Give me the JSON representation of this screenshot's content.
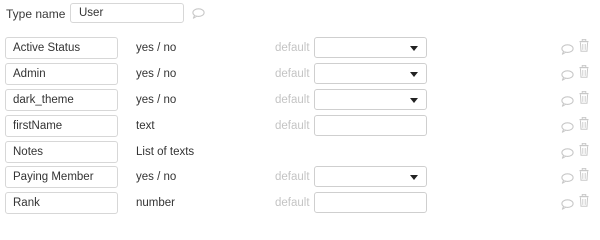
{
  "type_header": {
    "label": "Type name",
    "value": "User",
    "comment_icon": "comment-icon"
  },
  "fields": [
    {
      "name": "Active Status",
      "type": "yes / no",
      "default_label": "default",
      "default_control": "select",
      "default_value": ""
    },
    {
      "name": "Admin",
      "type": "yes / no",
      "default_label": "default",
      "default_control": "select",
      "default_value": ""
    },
    {
      "name": "dark_theme",
      "type": "yes / no",
      "default_label": "default",
      "default_control": "select",
      "default_value": ""
    },
    {
      "name": "firstName",
      "type": "text",
      "default_label": "default",
      "default_control": "text",
      "default_value": ""
    },
    {
      "name": "Notes",
      "type": "List of texts",
      "default_label": "",
      "default_control": "none",
      "default_value": ""
    },
    {
      "name": "Paying Member",
      "type": "yes / no",
      "default_label": "default",
      "default_control": "select",
      "default_value": ""
    },
    {
      "name": "Rank",
      "type": "number",
      "default_label": "default",
      "default_control": "text",
      "default_value": ""
    }
  ],
  "row_icons": [
    "comment-icon",
    "trash-icon"
  ],
  "colors": {
    "text": "#333333",
    "muted": "#c4c4c4",
    "border": "#d7d7d7",
    "icon": "#c8c8c8"
  }
}
